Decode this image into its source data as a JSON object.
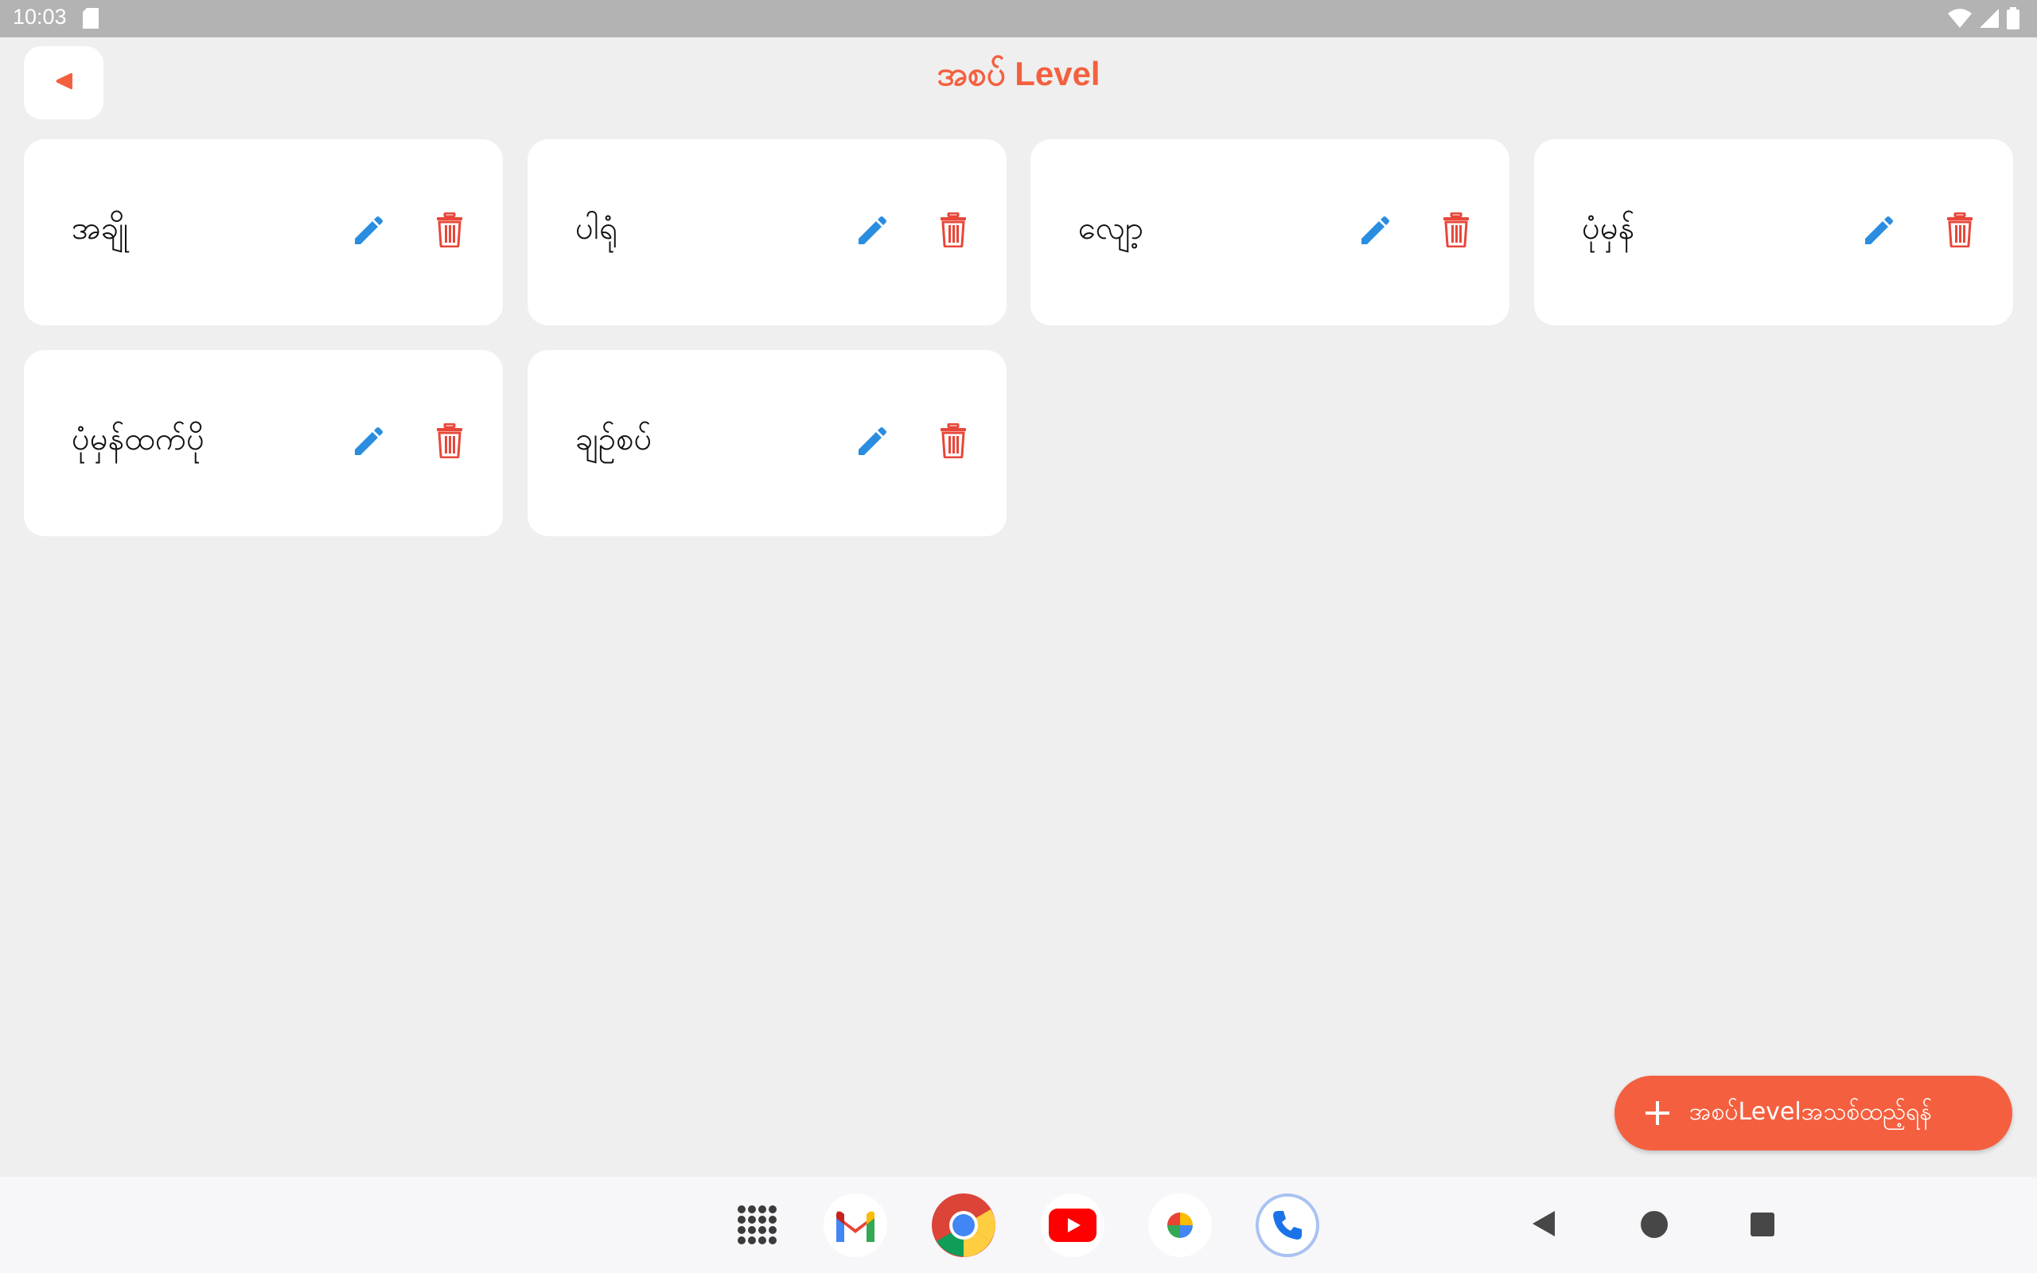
{
  "status_bar": {
    "time": "10:03"
  },
  "header": {
    "title": "အစပ် Level"
  },
  "cards": [
    {
      "label": "အချို"
    },
    {
      "label": "ပါရုံ"
    },
    {
      "label": "လျော့"
    },
    {
      "label": "ပုံမှန်"
    },
    {
      "label": "ပုံမှန်ထက်ပို"
    },
    {
      "label": "ချဉ်စပ်"
    }
  ],
  "fab": {
    "label": "အစပ်Levelအသစ်ထည့်ရန်"
  },
  "colors": {
    "accent": "#f4603f",
    "edit": "#2a8de0",
    "delete": "#e8473a",
    "background": "#efefef",
    "card": "#ffffff"
  },
  "dock": {
    "apps": [
      "app-drawer-icon",
      "gmail-icon",
      "chrome-icon",
      "youtube-icon",
      "photos-icon",
      "phone-icon"
    ]
  }
}
